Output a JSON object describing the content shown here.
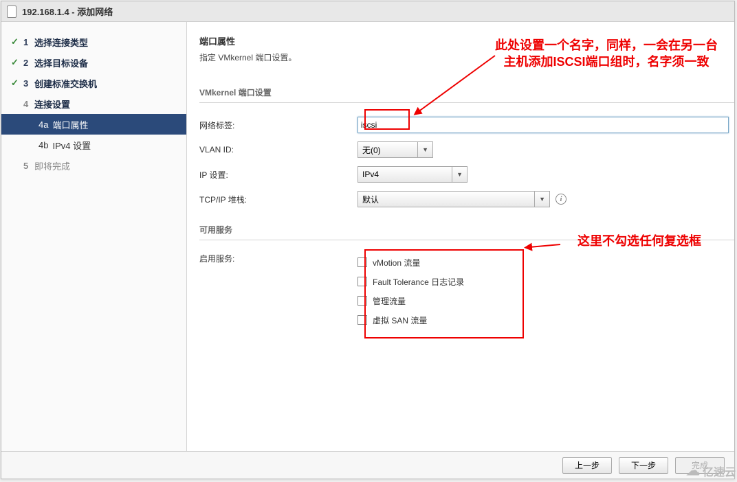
{
  "titlebar": {
    "text": "192.168.1.4 - 添加网络"
  },
  "sidebar": {
    "steps": [
      {
        "num": "1",
        "label": "选择连接类型"
      },
      {
        "num": "2",
        "label": "选择目标设备"
      },
      {
        "num": "3",
        "label": "创建标准交换机"
      },
      {
        "num": "4",
        "label": "连接设置"
      },
      {
        "num": "5",
        "label": "即将完成"
      }
    ],
    "substeps": {
      "a": {
        "id": "4a",
        "label": "端口属性"
      },
      "b": {
        "id": "4b",
        "label": "IPv4 设置"
      }
    }
  },
  "main": {
    "title": "端口属性",
    "desc": "指定 VMkernel 端口设置。",
    "group1_title": "VMkernel 端口设置",
    "fields": {
      "network_label_label": "网络标签:",
      "network_label_value": "iscsi",
      "vlan_label": "VLAN ID:",
      "vlan_value": "无(0)",
      "ip_label": "IP 设置:",
      "ip_value": "IPv4",
      "tcpip_label": "TCP/IP 堆栈:",
      "tcpip_value": "默认"
    },
    "group2_title": "可用服务",
    "services_label": "启用服务:",
    "services": {
      "vmotion": "vMotion 流量",
      "ft": "Fault Tolerance 日志记录",
      "mgmt": "管理流量",
      "vsan": "虚拟 SAN 流量"
    }
  },
  "annotations": {
    "a1": "此处设置一个名字，同样，一会在另一台主机添加ISCSI端口组时，名字须一致",
    "a2": "这里不勾选任何复选框"
  },
  "footer": {
    "back": "上一步",
    "next": "下一步",
    "finish": "完成"
  },
  "watermark": "亿速云"
}
